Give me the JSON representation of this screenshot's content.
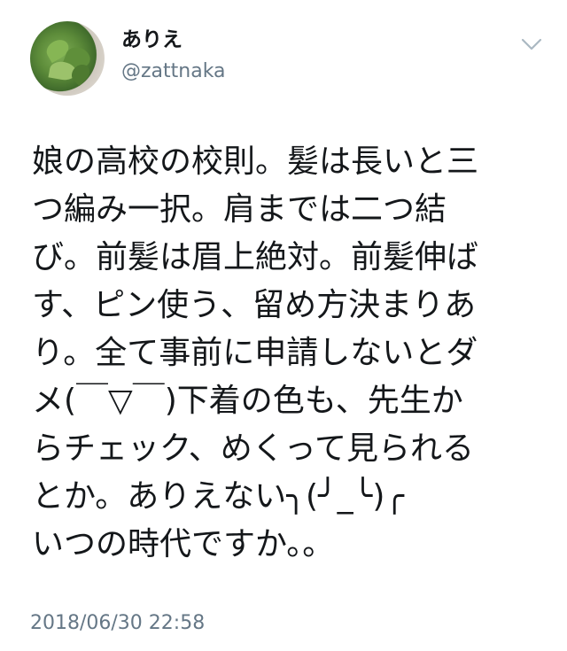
{
  "user": {
    "display_name": "ありえ",
    "handle": "@zattnaka"
  },
  "icons": {
    "menu": "chevron-down-icon"
  },
  "tweet": {
    "lines": [
      "娘の高校の校則。髪は長いと三",
      "つ編み一択。肩までは二つ結",
      "び。前髪は眉上絶対。前髪伸ば",
      "す、ピン使う、留め方決まりあ",
      "り。全て事前に申請しないとダ",
      "メ(￣▽￣)下着の色も、先生か",
      "らチェック、めくって見られる",
      "とか。ありえない╮(╯_╰)╭",
      "いつの時代ですか。。"
    ],
    "timestamp": "2018/06/30 22:58"
  },
  "colors": {
    "text": "#14171a",
    "secondary": "#657786"
  }
}
